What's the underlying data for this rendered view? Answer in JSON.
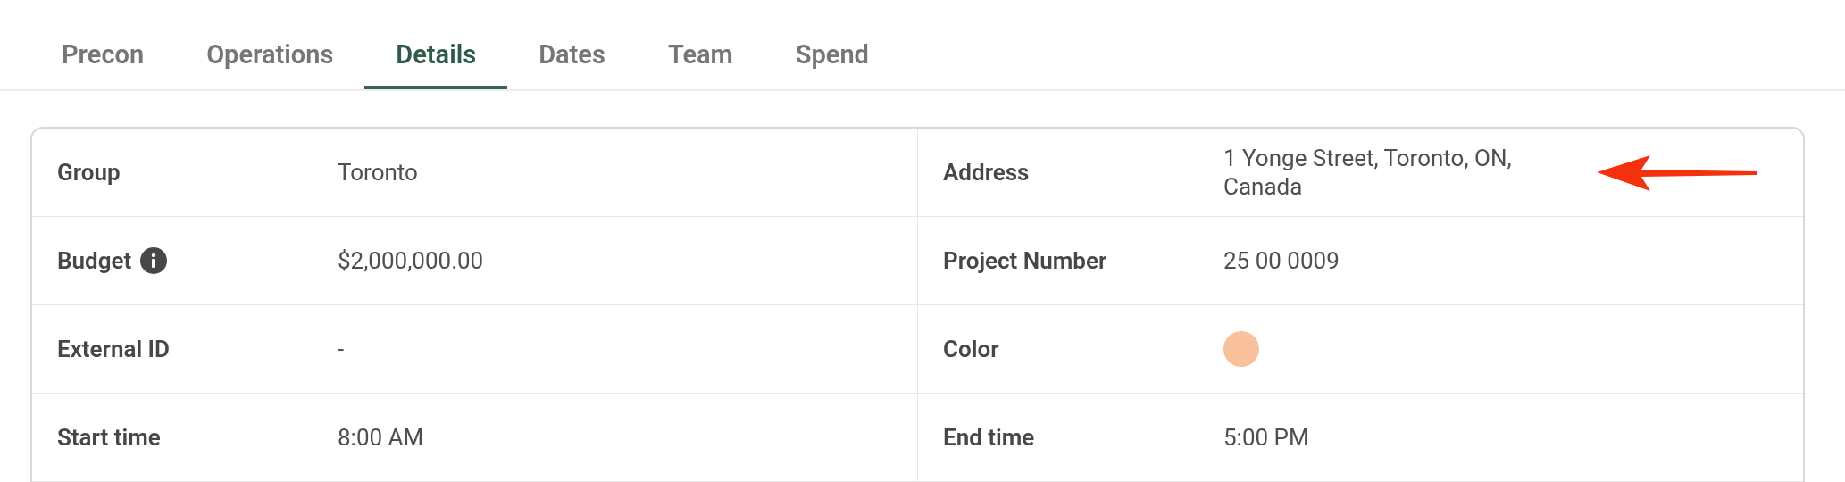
{
  "tabs": [
    {
      "label": "Precon",
      "selected": false
    },
    {
      "label": "Operations",
      "selected": false
    },
    {
      "label": "Details",
      "selected": true
    },
    {
      "label": "Dates",
      "selected": false
    },
    {
      "label": "Team",
      "selected": false
    },
    {
      "label": "Spend",
      "selected": false
    }
  ],
  "details": {
    "rows": [
      {
        "cells": [
          {
            "label": "Group",
            "kind": "text",
            "value": "Toronto"
          },
          {
            "label": "Address",
            "kind": "text",
            "value": "1 Yonge Street, Toronto, ON, Canada"
          }
        ]
      },
      {
        "cells": [
          {
            "label": "Budget",
            "info": true,
            "kind": "text",
            "value": "$2,000,000.00"
          },
          {
            "label": "Project Number",
            "kind": "text",
            "value": "25 00 0009"
          }
        ]
      },
      {
        "cells": [
          {
            "label": "External ID",
            "kind": "text",
            "value": "-"
          },
          {
            "label": "Color",
            "kind": "color",
            "color": "#f9c09c"
          }
        ]
      },
      {
        "cells": [
          {
            "label": "Start time",
            "kind": "text",
            "value": "8:00 AM"
          },
          {
            "label": "End time",
            "kind": "text",
            "value": "5:00 PM"
          }
        ]
      }
    ]
  }
}
